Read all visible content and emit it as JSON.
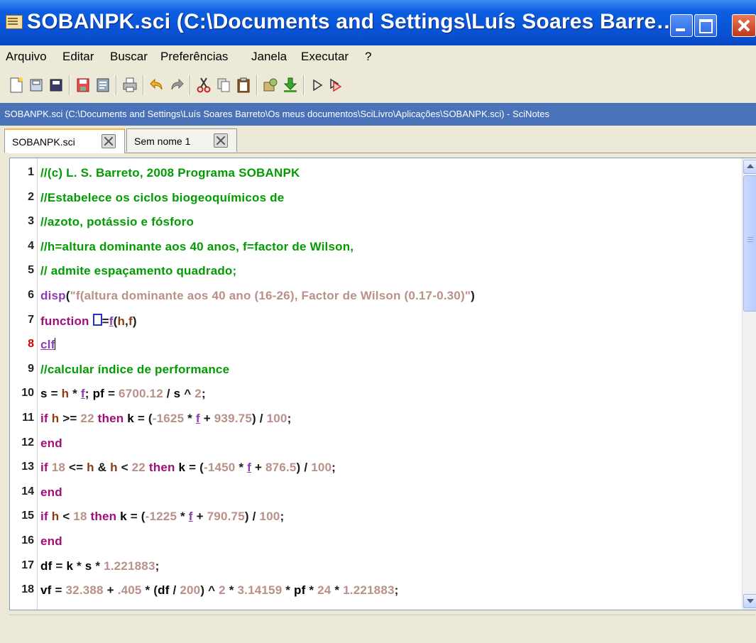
{
  "window": {
    "title": "SOBANPK.sci (C:\\Documents and Settings\\Luís Soares Barre…",
    "controls": [
      "minimize",
      "maximize",
      "close"
    ]
  },
  "menu": {
    "items": [
      "Arquivo",
      "Editar",
      "Buscar",
      "Preferências",
      "Janela",
      "Executar",
      "?"
    ]
  },
  "toolbar": {
    "icons": [
      "new-file-icon",
      "open-file-icon",
      "open-folder-icon",
      "save-icon",
      "save-as-icon",
      "print-icon",
      "undo-icon",
      "redo-icon",
      "cut-icon",
      "copy-icon",
      "paste-icon",
      "execute-file-icon",
      "load-into-scilab-icon",
      "run-icon",
      "run-selection-icon"
    ]
  },
  "path_bar": {
    "text": "SOBANPK.sci (C:\\Documents and Settings\\Luís Soares Barreto\\Os meus documentos\\SciLivro\\Aplicações\\SOBANPK.sci) - SciNotes"
  },
  "tabs": [
    {
      "label": "SOBANPK.sci",
      "active": true
    },
    {
      "label": "Sem nome 1",
      "active": false
    }
  ],
  "editor": {
    "current_line": 8,
    "line_numbers": [
      "1",
      "2",
      "3",
      "4",
      "5",
      "6",
      "7",
      "8",
      "9",
      "10",
      "11",
      "12",
      "13",
      "14",
      "15",
      "16",
      "17",
      "18"
    ],
    "lines": [
      [
        [
          "cm",
          "//(c) L. S. Barreto, 2008 Programa SOBANPK"
        ]
      ],
      [
        [
          "cm",
          "//Estabelece os ciclos biogeoquímicos de"
        ]
      ],
      [
        [
          "cm",
          "//azoto, potássio e fósforo"
        ]
      ],
      [
        [
          "cm",
          "//h=altura dominante aos 40 anos, f=factor de Wilson,"
        ]
      ],
      [
        [
          "cm",
          "// admite espaçamento quadrado;"
        ]
      ],
      [
        [
          "fn",
          "disp"
        ],
        [
          "pu",
          "("
        ],
        [
          "st",
          "\"f(altura dominante aos 40 ano (16-26), Factor de Wilson (0.17-0.30)\""
        ],
        [
          "pu",
          ")"
        ]
      ],
      [
        [
          "kw",
          "function "
        ],
        [
          "box",
          ""
        ],
        [
          "pu",
          "="
        ],
        [
          "uk",
          "f"
        ],
        [
          "pu",
          "("
        ],
        [
          "fv",
          "h"
        ],
        [
          "pu",
          ","
        ],
        [
          "fv",
          "f"
        ],
        [
          "pu",
          ")"
        ]
      ],
      [
        [
          "uk",
          "clf"
        ],
        [
          "caret",
          ""
        ]
      ],
      [
        [
          "cm",
          "//calcular índice de performance"
        ]
      ],
      [
        [
          "vr",
          "s"
        ],
        [
          "pu",
          " = "
        ],
        [
          "fv",
          "h"
        ],
        [
          "pu",
          " * "
        ],
        [
          "uk",
          "f"
        ],
        [
          "pu",
          "; "
        ],
        [
          "vr",
          "pf"
        ],
        [
          "pu",
          " = "
        ],
        [
          "nm",
          "6700.12"
        ],
        [
          "pu",
          " / "
        ],
        [
          "vr",
          "s"
        ],
        [
          "pu",
          " ^ "
        ],
        [
          "nm",
          "2"
        ],
        [
          "pu",
          ";"
        ]
      ],
      [
        [
          "kw",
          "if "
        ],
        [
          "fv",
          "h"
        ],
        [
          "pu",
          " >= "
        ],
        [
          "nm",
          "22"
        ],
        [
          "kw",
          " then "
        ],
        [
          "vr",
          "k"
        ],
        [
          "pu",
          " = ("
        ],
        [
          "nm",
          "-1625"
        ],
        [
          "pu",
          " * "
        ],
        [
          "uk",
          "f"
        ],
        [
          "pu",
          " + "
        ],
        [
          "nm",
          "939.75"
        ],
        [
          "pu",
          ") / "
        ],
        [
          "nm",
          "100"
        ],
        [
          "pu",
          ";"
        ]
      ],
      [
        [
          "kw",
          "end"
        ]
      ],
      [
        [
          "kw",
          "if "
        ],
        [
          "nm",
          "18"
        ],
        [
          "pu",
          " <= "
        ],
        [
          "fv",
          "h"
        ],
        [
          "pu",
          " & "
        ],
        [
          "fv",
          "h"
        ],
        [
          "pu",
          " < "
        ],
        [
          "nm",
          "22"
        ],
        [
          "kw",
          " then "
        ],
        [
          "vr",
          "k"
        ],
        [
          "pu",
          " = ("
        ],
        [
          "nm",
          "-1450"
        ],
        [
          "pu",
          " * "
        ],
        [
          "uk",
          "f"
        ],
        [
          "pu",
          " + "
        ],
        [
          "nm",
          "876.5"
        ],
        [
          "pu",
          ") / "
        ],
        [
          "nm",
          "100"
        ],
        [
          "pu",
          ";"
        ]
      ],
      [
        [
          "kw",
          "end"
        ]
      ],
      [
        [
          "kw",
          "if "
        ],
        [
          "fv",
          "h"
        ],
        [
          "pu",
          " < "
        ],
        [
          "nm",
          "18"
        ],
        [
          "kw",
          " then "
        ],
        [
          "vr",
          "k"
        ],
        [
          "pu",
          " = ("
        ],
        [
          "nm",
          "-1225"
        ],
        [
          "pu",
          " * "
        ],
        [
          "uk",
          "f"
        ],
        [
          "pu",
          " + "
        ],
        [
          "nm",
          "790.75"
        ],
        [
          "pu",
          ") / "
        ],
        [
          "nm",
          "100"
        ],
        [
          "pu",
          ";"
        ]
      ],
      [
        [
          "kw",
          "end"
        ]
      ],
      [
        [
          "vr",
          "df"
        ],
        [
          "pu",
          " = "
        ],
        [
          "vr",
          "k"
        ],
        [
          "pu",
          " * "
        ],
        [
          "vr",
          "s"
        ],
        [
          "pu",
          " * "
        ],
        [
          "nm",
          "1.221883"
        ],
        [
          "pu",
          ";"
        ]
      ],
      [
        [
          "vr",
          "vf"
        ],
        [
          "pu",
          " = "
        ],
        [
          "nm",
          "32.388"
        ],
        [
          "pu",
          " + "
        ],
        [
          "nm",
          ".405"
        ],
        [
          "pu",
          " * ("
        ],
        [
          "vr",
          "df"
        ],
        [
          "pu",
          " / "
        ],
        [
          "nm",
          "200"
        ],
        [
          "pu",
          ") ^ "
        ],
        [
          "nm",
          "2"
        ],
        [
          "pu",
          " * "
        ],
        [
          "nm",
          "3.14159"
        ],
        [
          "pu",
          " * "
        ],
        [
          "vr",
          "pf"
        ],
        [
          "pu",
          " * "
        ],
        [
          "nm",
          "24"
        ],
        [
          "pu",
          " * "
        ],
        [
          "nm",
          "1.221883"
        ],
        [
          "pu",
          ";"
        ]
      ]
    ]
  },
  "status_bar": {
    "text": ""
  }
}
